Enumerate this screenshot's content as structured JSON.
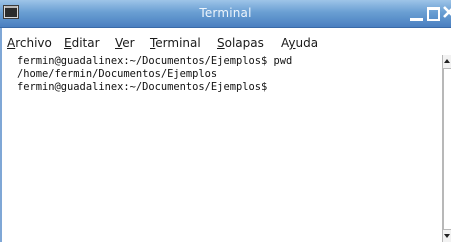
{
  "window": {
    "title": "Terminal"
  },
  "menubar": {
    "items": [
      {
        "label": "Archivo",
        "mnemonic": "A",
        "rest": "rchivo"
      },
      {
        "label": "Editar",
        "mnemonic": "E",
        "rest": "ditar"
      },
      {
        "label": "Ver",
        "mnemonic": "V",
        "rest": "er"
      },
      {
        "label": "Terminal",
        "mnemonic": "T",
        "rest": "erminal"
      },
      {
        "label": "Solapas",
        "mnemonic": "S",
        "rest": "olapas"
      },
      {
        "label": "Ayuda",
        "pre": "A",
        "mnemonic": "y",
        "rest": "uda"
      }
    ]
  },
  "terminal": {
    "lines": [
      "fermin@guadalinex:~/Documentos/Ejemplos$ pwd",
      "/home/fermin/Documentos/Ejemplos",
      "fermin@guadalinex:~/Documentos/Ejemplos$"
    ]
  },
  "colors": {
    "titlebar_top": "#9ec4e8",
    "titlebar_bottom": "#4a7fc0",
    "title_text": "#eef5fc"
  },
  "icons": {
    "window_icon": "terminal-icon",
    "minimize": "minimize-icon",
    "maximize": "maximize-icon",
    "close": "close-icon"
  }
}
